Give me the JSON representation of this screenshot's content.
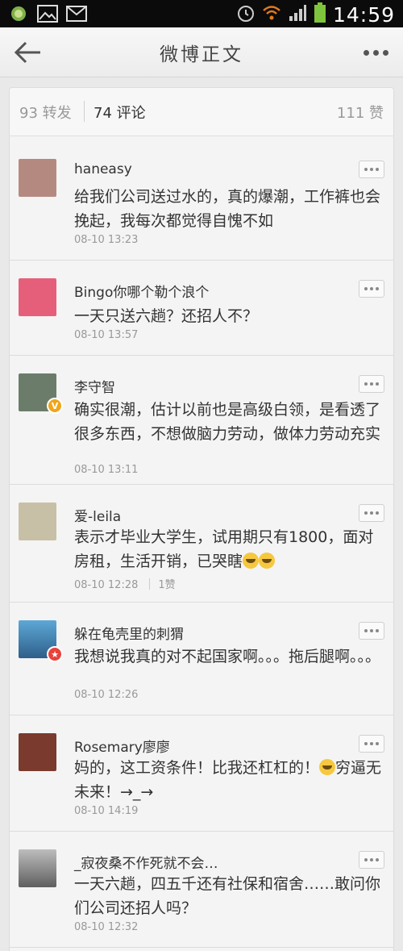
{
  "status_bar": {
    "time": "14:59",
    "icons": [
      "app-icon",
      "image-icon",
      "mail-icon",
      "alarm-icon",
      "wifi-icon",
      "signal-icon",
      "battery-icon"
    ]
  },
  "header": {
    "title": "微博正文",
    "back_icon": "back-arrow-icon",
    "more_icon": "more-dots-icon"
  },
  "tabs": {
    "reposts": "93 转发",
    "comments": "74 评论",
    "likes": "111 赞"
  },
  "comments": [
    {
      "username": "haneasy",
      "text": "给我们公司送过水的，真的爆潮，工作裤也会挽起，我每次都觉得自愧不如",
      "time": "08-10 13:23",
      "likes": "",
      "avatar_color": "#b48a80",
      "badge": ""
    },
    {
      "username": "Bingo你哪个勒个浪个",
      "text": "一天只送六趟？还招人不？",
      "time": "08-10 13:57",
      "likes": "",
      "avatar_color": "#e65f7a",
      "badge": ""
    },
    {
      "username": "李守智",
      "text": "确实很潮，估计以前也是高级白领，是看透了很多东西，不想做脑力劳动，做体力劳动充实",
      "time": "08-10 13:11",
      "likes": "",
      "avatar_color": "#6b7d6a",
      "badge": "V"
    },
    {
      "username": "爱-leila",
      "text": "表示才毕业大学生，试用期只有1800，面对房租，生活开销，已哭瞎",
      "time": "08-10 12:28",
      "likes": "1赞",
      "avatar_color": "#c7c0a6",
      "badge": ""
    },
    {
      "username": "躲在龟壳里的刺猬",
      "text": "我想说我真的对不起国家啊。。。拖后腿啊。。。",
      "time": "08-10 12:26",
      "likes": "",
      "avatar_color": "#4a89b8",
      "badge": "★"
    },
    {
      "username": "Rosemary廖廖",
      "text": "妈的，这工资条件！比我还杠杠的！",
      "text_after_emoji": "穷逼无未来！→_→",
      "time": "08-10 14:19",
      "likes": "",
      "avatar_color": "#7a3b2e",
      "badge": ""
    },
    {
      "username": "_寂夜桑不作死就不会…",
      "text": "一天六趟，四五千还有社保和宿舍……敢问你们公司还招人吗？",
      "time": "08-10 12:32",
      "likes": "",
      "avatar_color": "#8d8d8d",
      "badge": ""
    }
  ]
}
